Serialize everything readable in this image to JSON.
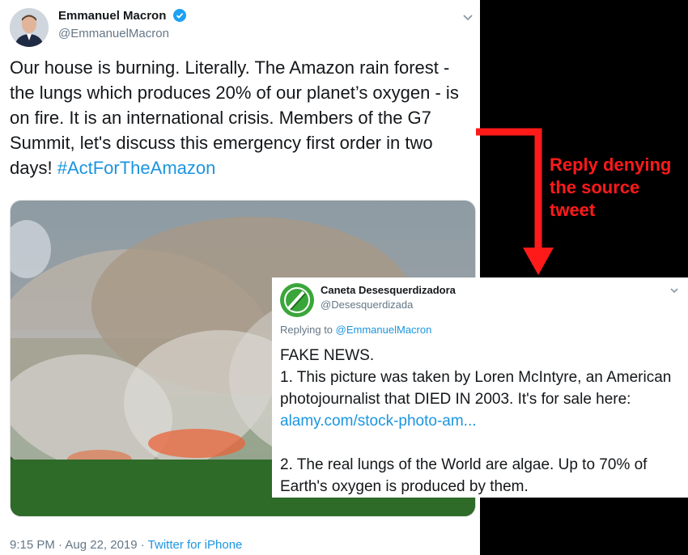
{
  "tweet": {
    "name": "Emmanuel Macron",
    "handle": "@EmmanuelMacron",
    "text": "Our house is burning. Literally. The Amazon rain forest - the lungs which produces 20% of our planet’s oxygen - is on fire. It is an international crisis. Members of the G7 Summit, let's discuss this emergency first order in two days!",
    "hashtag": "#ActForTheAmazon",
    "time": "9:15 PM · Aug 22, 2019 · ",
    "source": "Twitter for iPhone"
  },
  "annotation": {
    "text": "Reply denying\nthe source\ntweet",
    "color": "#ff1a1a"
  },
  "reply": {
    "name": "Caneta Desesquerdizadora",
    "handle": "@Desesquerdizada",
    "replying_prefix": "Replying to ",
    "replying_to": "@EmmanuelMacron",
    "line1": "FAKE NEWS.",
    "line2": "1. This picture was taken by Loren McIntyre, an American photojournalist that DIED IN 2003. It's for sale here: ",
    "link": "alamy.com/stock-photo-am...",
    "line3": "2. The real lungs of the World are algae. Up to 70% of Earth's oxygen is produced by them."
  },
  "colors": {
    "link": "#1b95e0",
    "verified": "#1da1f2",
    "reply_avatar": "#3aa63a"
  },
  "icons": [
    "verified-badge-icon",
    "chevron-down-icon",
    "arrow-icon"
  ]
}
